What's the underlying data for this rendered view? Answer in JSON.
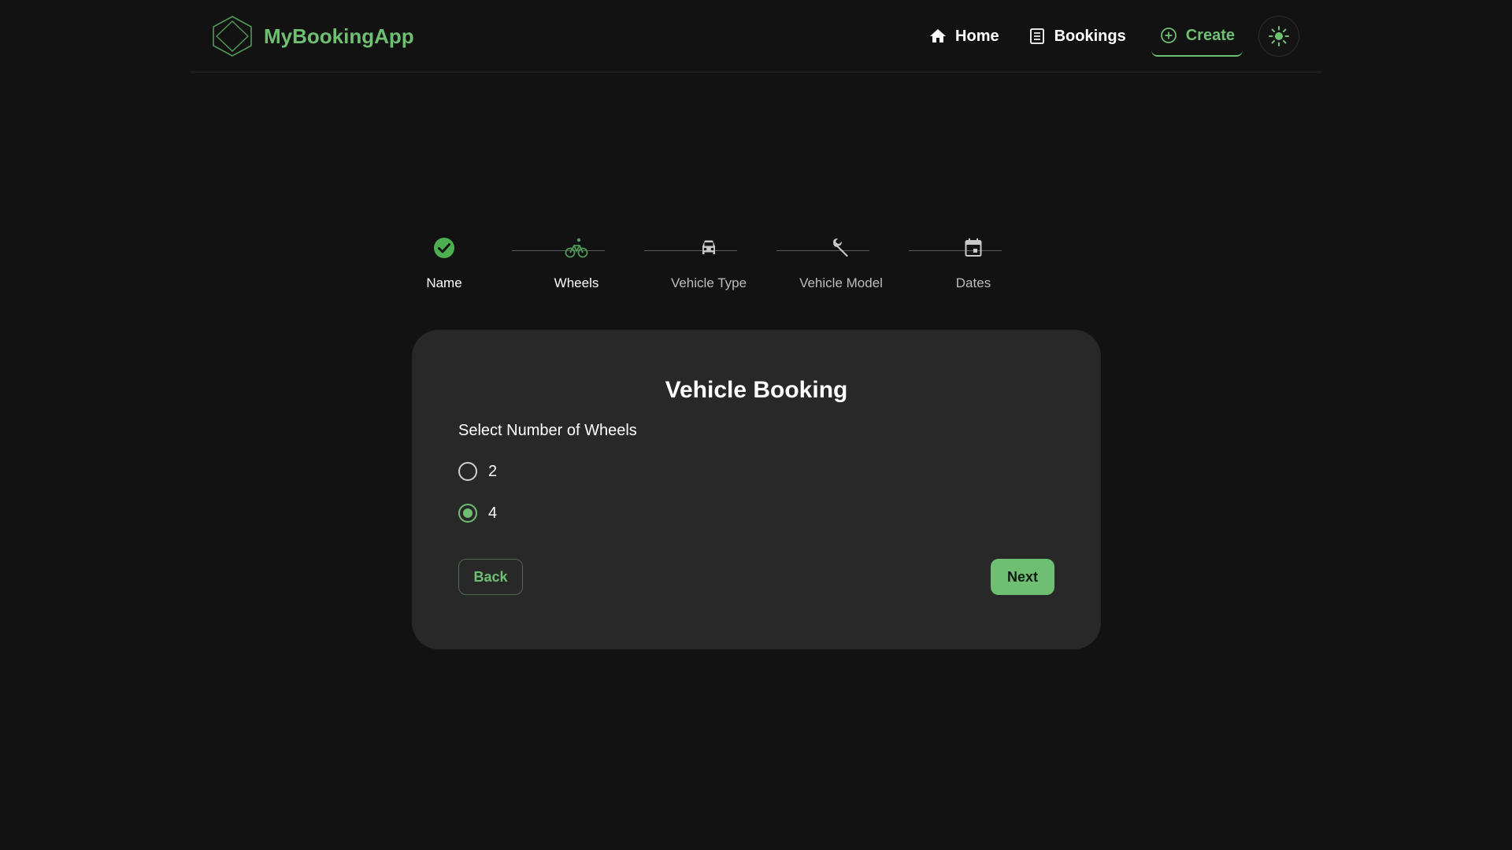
{
  "header": {
    "brand_name": "MyBookingApp",
    "nav": {
      "home": "Home",
      "bookings": "Bookings",
      "create": "Create"
    },
    "theme_toggle_icon": "sun-icon"
  },
  "stepper": {
    "steps": [
      {
        "label": "Name",
        "icon": "check-circle-icon",
        "state": "completed"
      },
      {
        "label": "Wheels",
        "icon": "bicycle-icon",
        "state": "active"
      },
      {
        "label": "Vehicle Type",
        "icon": "car-icon",
        "state": "pending"
      },
      {
        "label": "Vehicle Model",
        "icon": "wrench-icon",
        "state": "pending"
      },
      {
        "label": "Dates",
        "icon": "calendar-icon",
        "state": "pending"
      }
    ]
  },
  "form": {
    "title": "Vehicle Booking",
    "field_label": "Select Number of Wheels",
    "options": [
      {
        "label": "2",
        "selected": false
      },
      {
        "label": "4",
        "selected": true
      }
    ],
    "back_label": "Back",
    "next_label": "Next"
  },
  "colors": {
    "accent": "#6fbf73",
    "background": "#121212",
    "card": "#282828"
  }
}
